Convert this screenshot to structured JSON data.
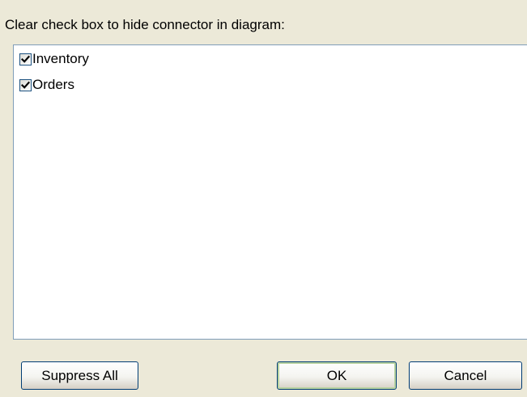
{
  "dialog": {
    "instruction": "Clear check box to hide connector in diagram:"
  },
  "connectors": [
    {
      "label": "Inventory",
      "checked": true
    },
    {
      "label": "Orders",
      "checked": true
    }
  ],
  "buttons": {
    "suppress_all": "Suppress All",
    "ok": "OK",
    "cancel": "Cancel"
  },
  "icons": {
    "checkmark": "checkmark-icon"
  },
  "colors": {
    "dialog_background": "#ece9d8",
    "list_border": "#7f9db9",
    "checkbox_border": "#1c5180",
    "button_border": "#003c74",
    "default_button_glow": "#b8d3a1"
  }
}
